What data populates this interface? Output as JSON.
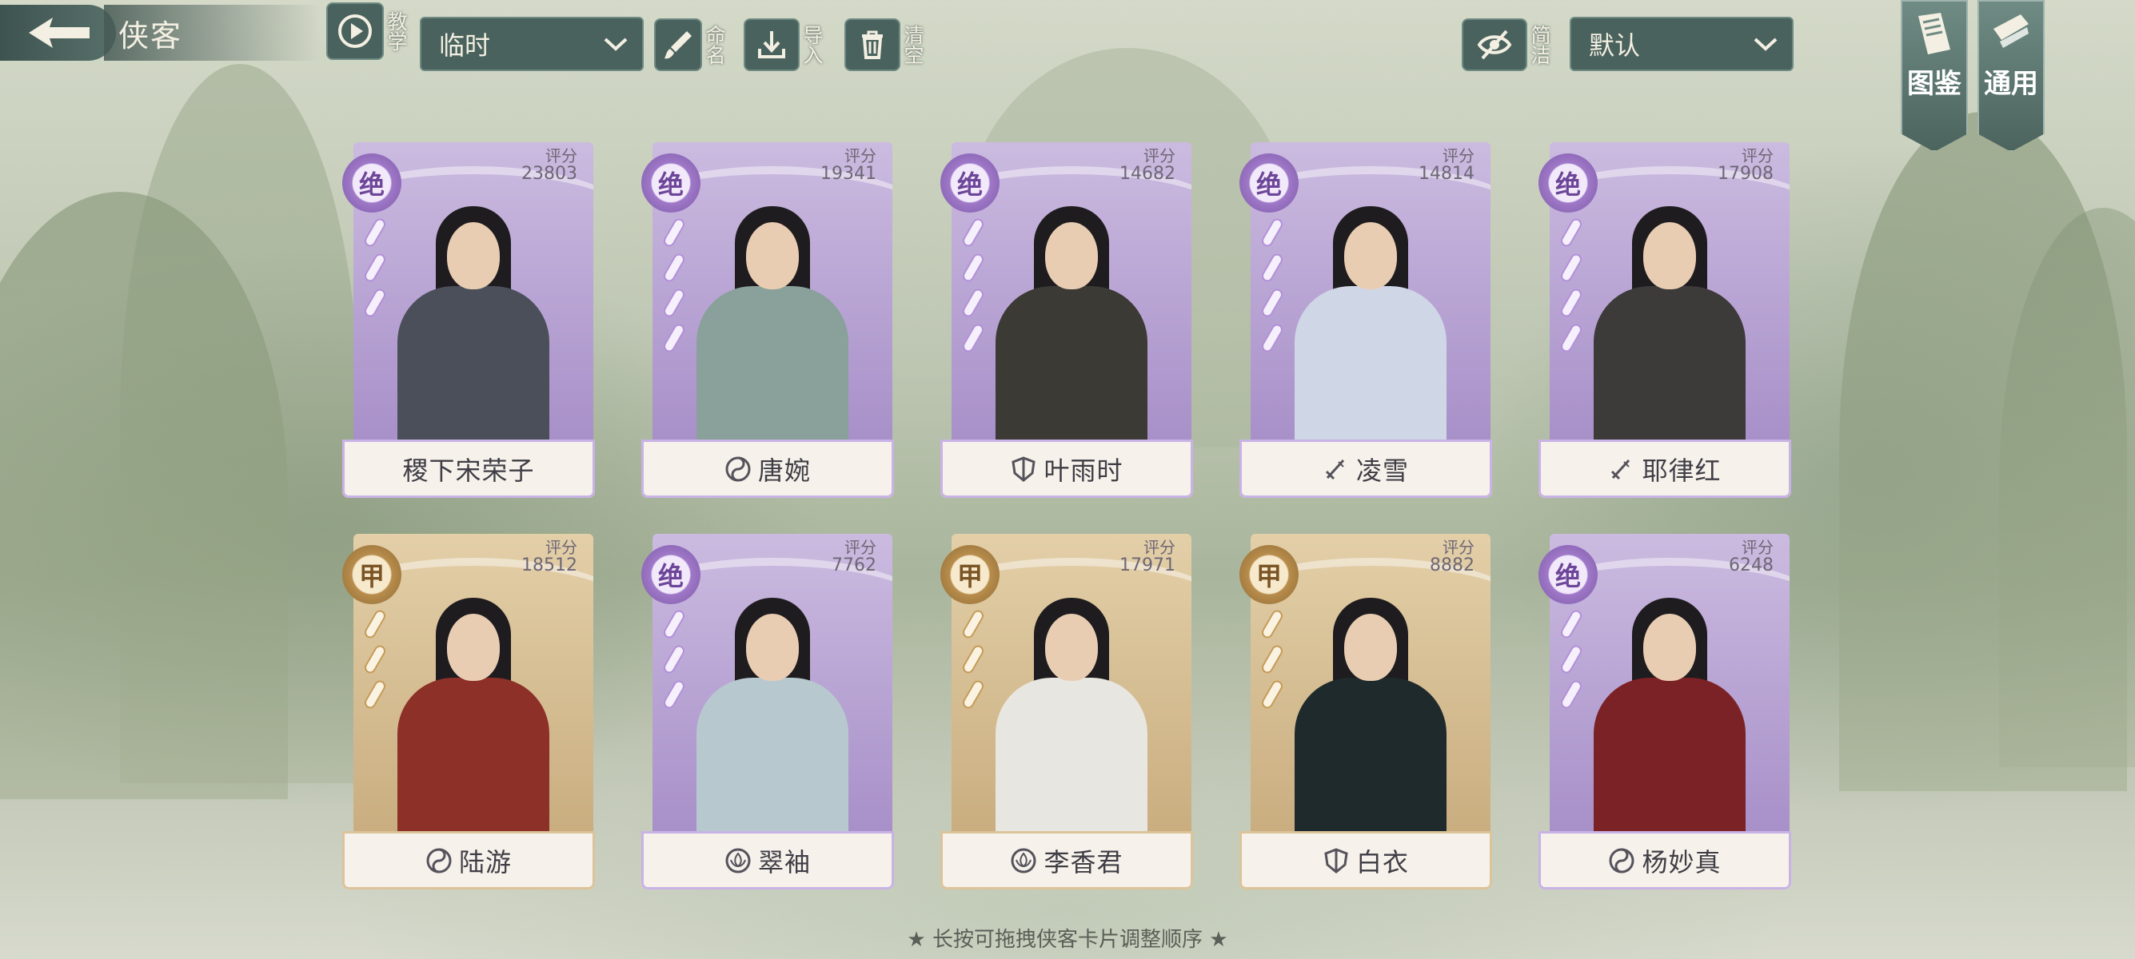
{
  "header": {
    "title": "侠客",
    "tutorial_label": "教学",
    "team_select_value": "临时",
    "rename_label": "命名",
    "import_label": "导入",
    "clear_label": "清空",
    "simple_label": "简洁",
    "sort_select_value": "默认"
  },
  "side_tabs": [
    {
      "label": "图鉴",
      "icon": "book-icon"
    },
    {
      "label": "通用",
      "icon": "scroll-icon"
    }
  ],
  "score_label": "评分",
  "cards": [
    {
      "name": "稷下宋荣子",
      "rank": "绝",
      "score": "23803",
      "tier": "purple",
      "sect_icon": "",
      "swords": 3,
      "body_color": "#4b4f5a"
    },
    {
      "name": "唐婉",
      "rank": "绝",
      "score": "19341",
      "tier": "purple",
      "sect_icon": "yin-yang-icon",
      "swords": 4,
      "body_color": "#8aa09a"
    },
    {
      "name": "叶雨时",
      "rank": "绝",
      "score": "14682",
      "tier": "purple",
      "sect_icon": "shield-icon",
      "swords": 4,
      "body_color": "#3b3a35"
    },
    {
      "name": "凌雪",
      "rank": "绝",
      "score": "14814",
      "tier": "purple",
      "sect_icon": "sword-icon",
      "swords": 4,
      "body_color": "#cfd6e6"
    },
    {
      "name": "耶律红",
      "rank": "绝",
      "score": "17908",
      "tier": "purple",
      "sect_icon": "sword-icon",
      "swords": 4,
      "body_color": "#3d3a3a"
    },
    {
      "name": "陆游",
      "rank": "甲",
      "score": "18512",
      "tier": "gold",
      "sect_icon": "yin-yang-icon",
      "swords": 3,
      "body_color": "#8d3027"
    },
    {
      "name": "翠袖",
      "rank": "绝",
      "score": "7762",
      "tier": "purple",
      "sect_icon": "lotus-icon",
      "swords": 3,
      "body_color": "#b7c9cf"
    },
    {
      "name": "李香君",
      "rank": "甲",
      "score": "17971",
      "tier": "gold",
      "sect_icon": "lotus-icon",
      "swords": 3,
      "body_color": "#e8e6e1"
    },
    {
      "name": "白衣",
      "rank": "甲",
      "score": "8882",
      "tier": "gold",
      "sect_icon": "shield-icon",
      "swords": 3,
      "body_color": "#1f2a2c"
    },
    {
      "name": "杨妙真",
      "rank": "绝",
      "score": "6248",
      "tier": "purple",
      "sect_icon": "yin-yang-icon",
      "swords": 3,
      "body_color": "#7b2226"
    }
  ],
  "hint": "★ 长按可拖拽侠客卡片调整顺序 ★",
  "colors": {
    "purple_tier": "#9f79c8",
    "gold_tier": "#b88d4c",
    "ui_teal": "#4a625d"
  }
}
